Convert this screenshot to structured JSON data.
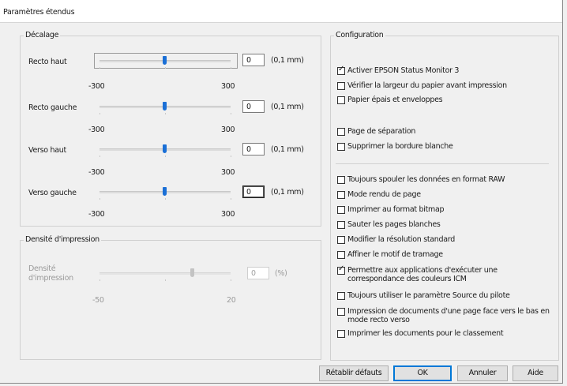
{
  "window": {
    "title": "Paramètres étendus"
  },
  "offset_group": {
    "legend": "Décalage",
    "unit": "(0,1 mm)",
    "rows": [
      {
        "label": "Recto haut",
        "value": "0",
        "min": "-300",
        "max": "300"
      },
      {
        "label": "Recto gauche",
        "value": "0",
        "min": "-300",
        "max": "300"
      },
      {
        "label": "Verso haut",
        "value": "0",
        "min": "-300",
        "max": "300"
      },
      {
        "label": "Verso gauche",
        "value": "0",
        "min": "-300",
        "max": "300"
      }
    ]
  },
  "density_group": {
    "legend": "Densité d'impression",
    "label_line1": "Densité",
    "label_line2": "d'impression",
    "value": "0",
    "unit": "(%)",
    "min": "-50",
    "max": "20"
  },
  "config_group": {
    "legend": "Configuration",
    "options": [
      {
        "label": "Activer EPSON Status Monitor 3",
        "checked": true
      },
      {
        "label": "Vérifier la largeur du papier avant impression",
        "checked": false
      },
      {
        "label": "Papier épais et enveloppes",
        "checked": false
      },
      {
        "label": "Page de séparation",
        "checked": false
      },
      {
        "label": "Supprimer la bordure blanche",
        "checked": false
      },
      {
        "label": "Toujours spouler les données en format RAW",
        "checked": false
      },
      {
        "label": "Mode rendu de page",
        "checked": false
      },
      {
        "label": "Imprimer au format bitmap",
        "checked": false
      },
      {
        "label": "Sauter les pages blanches",
        "checked": false
      },
      {
        "label": "Modifier la résolution standard",
        "checked": false
      },
      {
        "label": "Affiner le motif de tramage",
        "checked": false
      },
      {
        "label": "Permettre aux applications d'exécuter une correspondance des couleurs ICM",
        "checked": true
      },
      {
        "label": "Toujours utiliser le paramètre Source du pilote",
        "checked": false
      },
      {
        "label": "Impression de documents d'une page face vers le bas en mode recto verso",
        "checked": false
      },
      {
        "label": "Imprimer les documents pour le classement",
        "checked": false
      }
    ]
  },
  "buttons": {
    "reset": "Rétablir défauts",
    "ok": "OK",
    "cancel": "Annuler",
    "help": "Aide"
  },
  "colors": {
    "slider_thumb": "#1a6fd6",
    "default_button_border": "#0078d7"
  }
}
